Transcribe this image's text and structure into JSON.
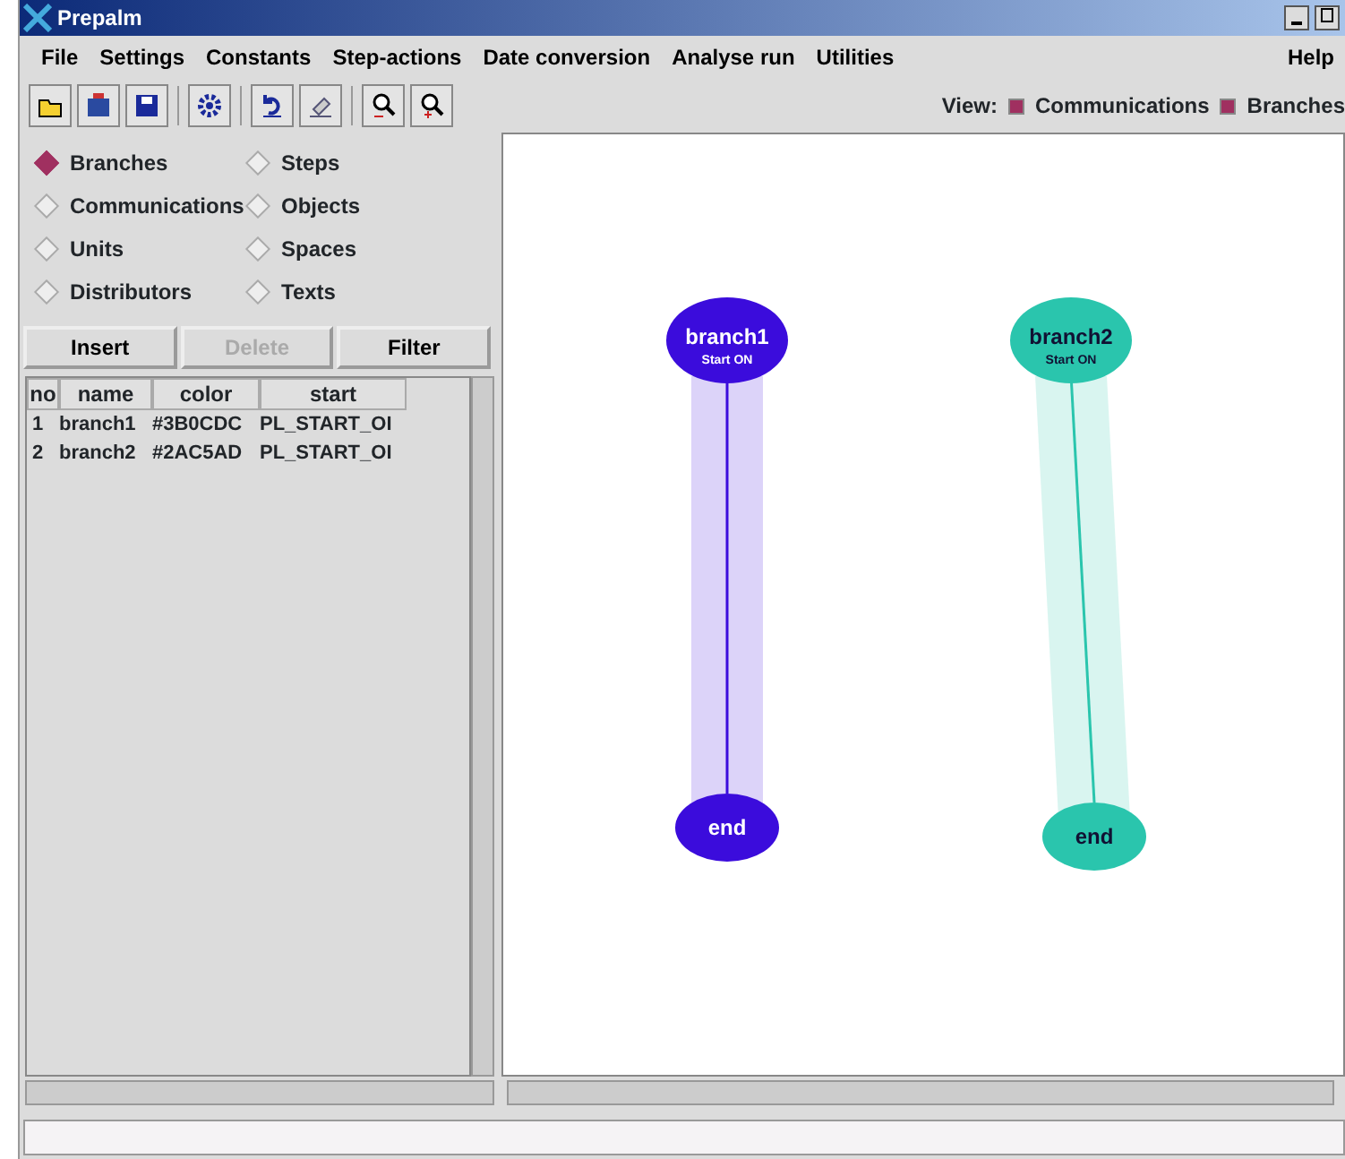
{
  "window": {
    "title": "Prepalm"
  },
  "menu": [
    "File",
    "Settings",
    "Constants",
    "Step-actions",
    "Date conversion",
    "Analyse run",
    "Utilities",
    "Help"
  ],
  "view": {
    "label": "View:",
    "options": [
      {
        "label": "Communications",
        "checked": true
      },
      {
        "label": "Branches",
        "checked": true
      }
    ]
  },
  "object_types": [
    {
      "label": "Branches",
      "selected": true
    },
    {
      "label": "Steps",
      "selected": false
    },
    {
      "label": "Communications",
      "selected": false
    },
    {
      "label": "Objects",
      "selected": false
    },
    {
      "label": "Units",
      "selected": false
    },
    {
      "label": "Spaces",
      "selected": false
    },
    {
      "label": "Distributors",
      "selected": false
    },
    {
      "label": "Texts",
      "selected": false
    }
  ],
  "buttons": [
    {
      "label": "Insert",
      "disabled": false
    },
    {
      "label": "Delete",
      "disabled": true
    },
    {
      "label": "Filter",
      "disabled": false
    }
  ],
  "table": {
    "columns": [
      "no",
      "name",
      "color",
      "start"
    ],
    "rows": [
      [
        "1",
        "branch1",
        "#3B0CDC",
        "PL_START_OI"
      ],
      [
        "2",
        "branch2",
        "#2AC5AD",
        "PL_START_OI"
      ]
    ]
  },
  "canvas": {
    "branches": [
      {
        "name": "branch1",
        "status": "Start ON",
        "end": "end",
        "color": "#3b0cdc"
      },
      {
        "name": "branch2",
        "status": "Start ON",
        "end": "end",
        "color": "#2ac5ad"
      }
    ]
  }
}
